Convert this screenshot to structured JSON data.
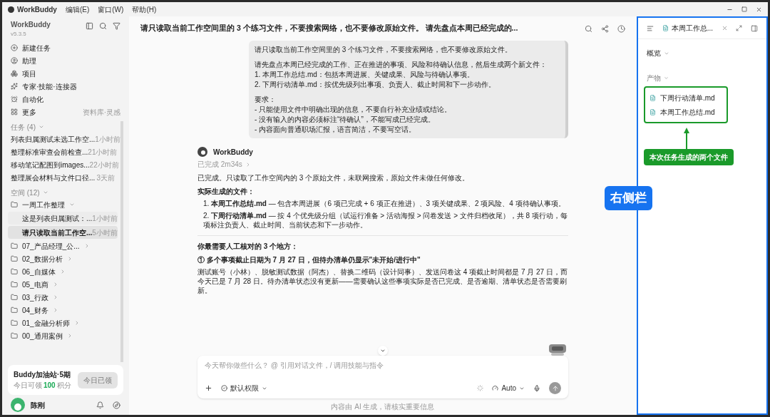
{
  "menu_bar": {
    "app": "WorkBuddy",
    "menus": [
      "编辑(E)",
      "窗口(W)",
      "帮助(H)"
    ]
  },
  "sidebar": {
    "title": "WorkBuddy",
    "version": "v5.3.5",
    "nav": [
      {
        "label": "新建任务"
      },
      {
        "label": "助理"
      },
      {
        "label": "项目"
      },
      {
        "label": "专家·技能·连接器"
      },
      {
        "label": "自动化"
      },
      {
        "label": "更多",
        "hint": "资料库·灵感"
      }
    ],
    "tasks_header": "任务 (4)",
    "tasks": [
      {
        "title": "列表归属测试未选工作空...",
        "time": "1小时前"
      },
      {
        "title": "整理标准审查会前检查...",
        "time": "21小时前"
      },
      {
        "title": "移动笔记配图到images...",
        "time": "22小时前"
      },
      {
        "title": "整理展会材料与文件口径...",
        "time": "3天前"
      }
    ],
    "spaces_header": "空间 (12)",
    "spaces": [
      {
        "name": "一周工作整理",
        "expanded": true,
        "children": [
          {
            "title": "这是列表归属测试：...",
            "time": "1小时前",
            "selected": false
          },
          {
            "title": "请只读取当前工作空...",
            "time": "5小时前",
            "selected": true
          }
        ]
      },
      {
        "name": "07_产品经理_公...",
        "expanded": false
      },
      {
        "name": "02_数据分析",
        "expanded": false
      },
      {
        "name": "06_自媒体",
        "expanded": false
      },
      {
        "name": "05_电商",
        "expanded": false
      },
      {
        "name": "03_行政",
        "expanded": false
      },
      {
        "name": "04_财务",
        "expanded": false
      },
      {
        "name": "01_金融分析师",
        "expanded": false
      },
      {
        "name": "00_通用案例",
        "expanded": false
      }
    ],
    "promo": {
      "title": "Buddy加油站·5期",
      "text": "今日可领",
      "points": "100",
      "unit": "积分",
      "button": "今日已领",
      "disabled": true
    },
    "user": {
      "name": "陈刚"
    }
  },
  "main": {
    "title": "请只读取当前工作空间里的 3 个练习文件，不要搜索网络，也不要修改原始文件。 请先盘点本周已经完成的...",
    "user_message": [
      [
        "请只读取当前工作空间里的 3 个练习文件，不要搜索网络，也不要修改原始文件。"
      ],
      [
        "请先盘点本周已经完成的工作、正在推进的事项、风险和待确认信息，然后生成两个新文件：",
        "1. 本周工作总结.md：包括本周进展、关键成果、风险与待确认事项。",
        "2. 下周行动清单.md：按优先级列出事项、负责人、截止时间和下一步动作。"
      ],
      [
        "要求：",
        "- 只能使用文件中明确出现的信息，不要自行补充业绩或结论。",
        "- 没有输入的内容必须标注“待确认”，不能写成已经完成。",
        "- 内容面向普通职场汇报，语言简洁，不要写空话。"
      ]
    ],
    "assistant": {
      "name": "WorkBuddy",
      "status": "已完成 2m34s",
      "intro": "已完成。只读取了工作空间内的 3 个原始文件，未联网搜索，原始文件未做任何修改。",
      "files_heading": "实际生成的文件：",
      "files": [
        "1. **本周工作总结.md** — 包含本周进展（6 项已完成 + 6 项正在推进）、3 项关键成果、2 项风险、4 项待确认事项。",
        "2. **下周行动清单.md** — 按 4 个优先级分组（试运行准备 > 活动海报 > 问卷发送 > 文件归档收尾），共 8 项行动，每项标注负责人、截止时间、当前状态和下一步动作。"
      ],
      "review_heading": "你最需要人工核对的 3 个地方：",
      "issue_title": "① 多个事项截止日期为 7 月 27 日，但待办清单仍显示\"未开始/进行中\"",
      "issue_text": "测试账号（小林）、脱敏测试数据（阿杰）、替换二维码（设计同事）、发送问卷这 4 项截止时间都是 7 月 27 日，而今天已是 7 月 28 日。待办清单状态没有更新——需要确认这些事项实际是否已完成、是否逾期、清单状态是否需要刷新。"
    },
    "input": {
      "placeholder": "今天帮你做些什么？ @ 引用对话文件，/ 调用技能与指令",
      "permission": "默认权限",
      "model": "Auto"
    },
    "footer": "内容由 AI 生成，请核实重要信息"
  },
  "right_panel": {
    "tab_title": "本周工作总...",
    "overview": "概览",
    "outputs_label": "产物",
    "files": [
      "下周行动清单.md",
      "本周工作总结.md"
    ]
  },
  "annotations": {
    "callout": "本次任务生成的两个文件",
    "panel_label": "右侧栏"
  }
}
